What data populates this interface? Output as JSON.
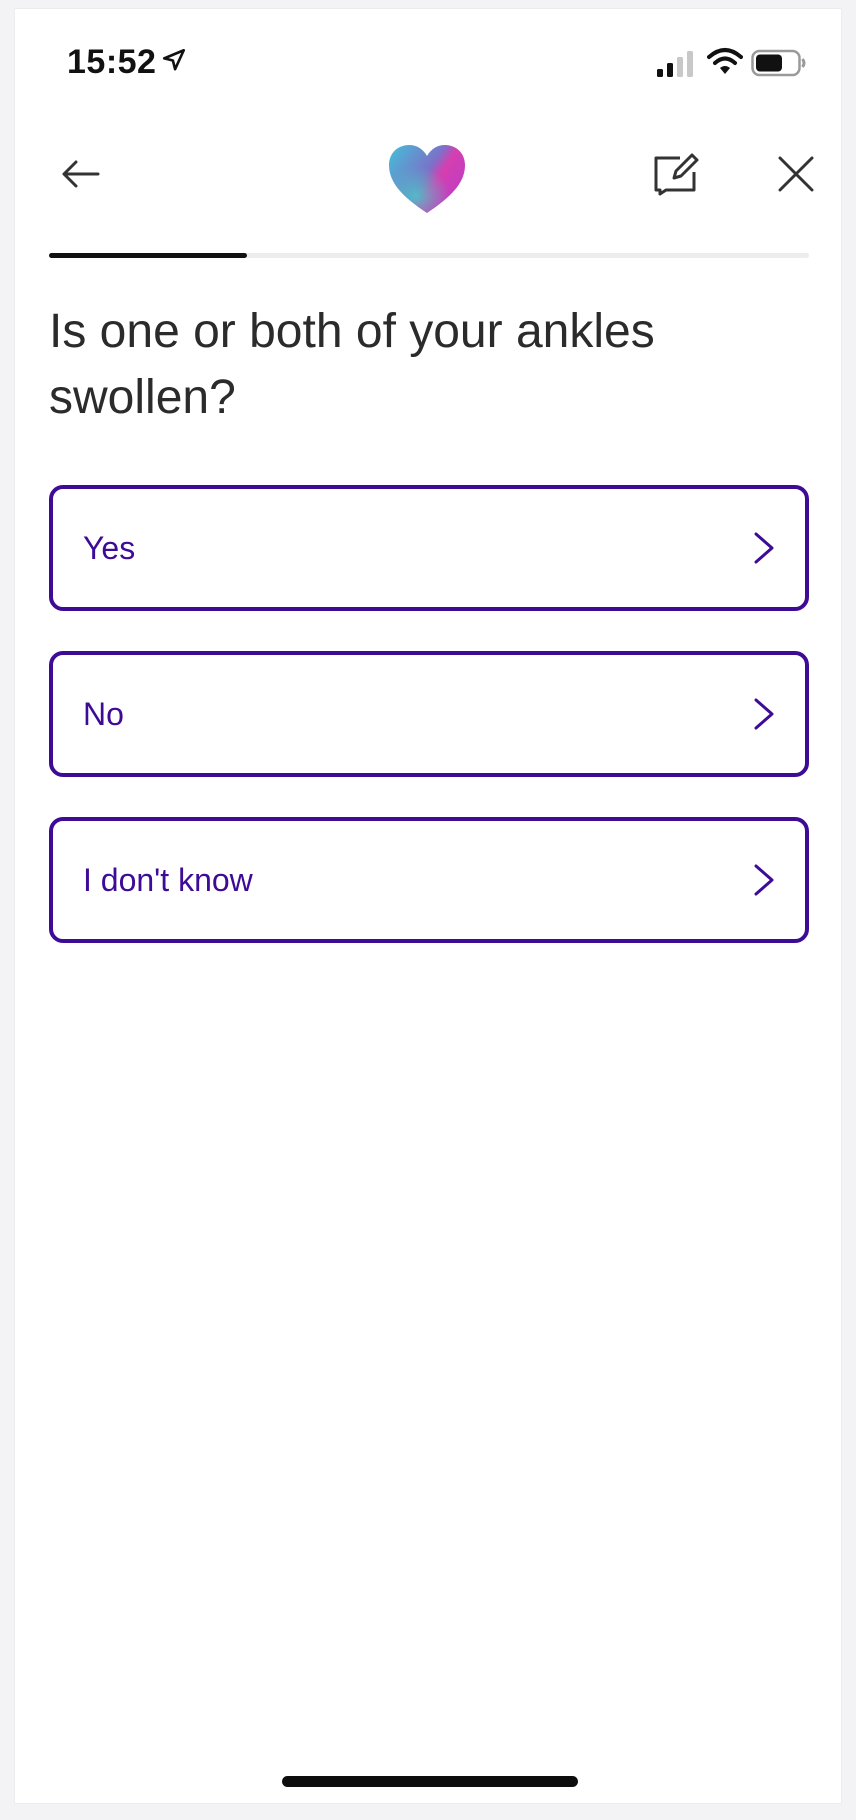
{
  "status_bar": {
    "time": "15:52",
    "icons": [
      "location-arrow-icon",
      "cellular-signal-icon",
      "wifi-icon",
      "battery-icon"
    ]
  },
  "header": {
    "back_icon": "arrow-left-icon",
    "logo_icon": "heart-logo-icon",
    "feedback_icon": "compose-feedback-icon",
    "close_icon": "close-icon"
  },
  "progress": {
    "value": 0.26
  },
  "question": "Is one or both of your ankles swollen?",
  "options": [
    {
      "label": "Yes"
    },
    {
      "label": "No"
    },
    {
      "label": "I don't know"
    }
  ],
  "colors": {
    "accent": "#3d0b96",
    "text": "#2b2b2b",
    "progress_fill": "#111111",
    "progress_track": "#ededed"
  }
}
